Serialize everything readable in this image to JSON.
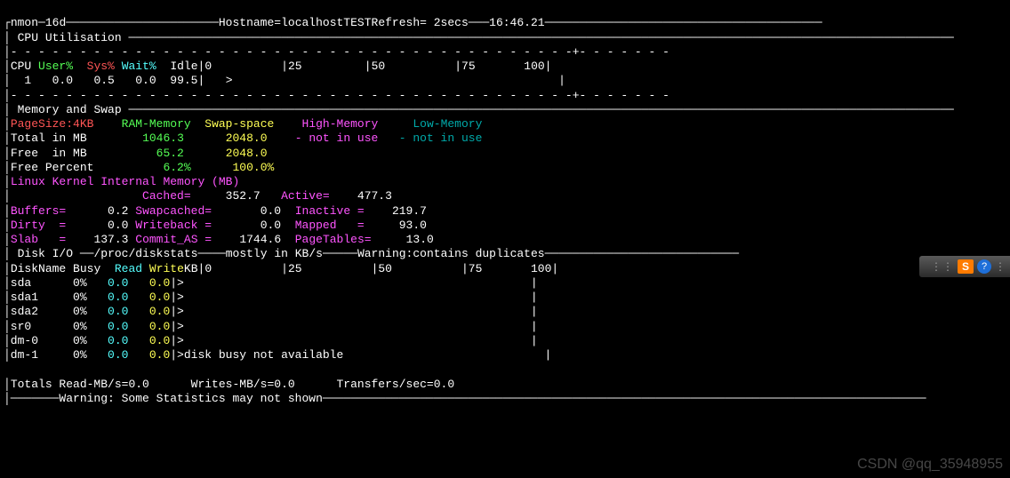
{
  "header": {
    "program": "nmon",
    "version": "16d",
    "hostname": "localhostTEST",
    "refresh": "2secs",
    "time": "16:46.21"
  },
  "cpu_section": {
    "title": "CPU Utilisation",
    "cols": {
      "cpu": "CPU",
      "user": "User%",
      "sys": "Sys%",
      "wait": "Wait%",
      "idle": "Idle"
    },
    "row1": {
      "cpu": "1",
      "user": "0.0",
      "sys": "0.5",
      "wait": "0.0",
      "idle": "99.5",
      "bar": ">"
    },
    "axis": {
      "t0": "0",
      "t25": "25",
      "t50": "50",
      "t75": "75",
      "t100": "100"
    }
  },
  "mem_section": {
    "title": "Memory and Swap",
    "pagesize": "PageSize:4KB",
    "col_ram": "RAM-Memory",
    "col_swap": "Swap-space",
    "col_high": "High-Memory",
    "col_low": "Low-Memory",
    "total_label": "Total in MB",
    "total_ram": "1046.3",
    "total_swap": "2048.0",
    "high_val": "- not in use",
    "low_val": "- not in use",
    "free_label": "Free  in MB",
    "free_ram": "65.2",
    "free_swap": "2048.0",
    "freep_label": "Free Percent",
    "freep_ram": "6.2%",
    "freep_swap": "100.0%",
    "kernel_hdr": "Linux Kernel Internal Memory (MB)",
    "k": {
      "cached_l": "Cached=",
      "cached_v": "352.7",
      "active_l": "Active=",
      "active_v": "477.3",
      "buffers_l": "Buffers=",
      "buffers_v": "0.2",
      "swapc_l": "Swapcached=",
      "swapc_v": "0.0",
      "inactive_l": "Inactive =",
      "inactive_v": "219.7",
      "dirty_l": "Dirty  =",
      "dirty_v": "0.0",
      "wb_l": "Writeback =",
      "wb_v": "0.0",
      "mapped_l": "Mapped   =",
      "mapped_v": "93.0",
      "slab_l": "Slab   =",
      "slab_v": "137.3",
      "commit_l": "Commit_AS =",
      "commit_v": "1744.6",
      "pt_l": "PageTables=",
      "pt_v": "13.0"
    }
  },
  "disk_section": {
    "title": "Disk I/O",
    "src": "/proc/diskstats",
    "units": "mostly in KB/s",
    "warn": "Warning:contains duplicates",
    "cols": {
      "name": "DiskName",
      "busy": "Busy",
      "read": "Read",
      "write": "Write",
      "kb": "KB"
    },
    "rows": [
      {
        "name": "sda",
        "busy": "0%",
        "read": "0.0",
        "write": "0.0",
        "bar": ">"
      },
      {
        "name": "sda1",
        "busy": "0%",
        "read": "0.0",
        "write": "0.0",
        "bar": ">"
      },
      {
        "name": "sda2",
        "busy": "0%",
        "read": "0.0",
        "write": "0.0",
        "bar": ">"
      },
      {
        "name": "sr0",
        "busy": "0%",
        "read": "0.0",
        "write": "0.0",
        "bar": ">"
      },
      {
        "name": "dm-0",
        "busy": "0%",
        "read": "0.0",
        "write": "0.0",
        "bar": ">"
      },
      {
        "name": "dm-1",
        "busy": "0%",
        "read": "0.0",
        "write": "0.0",
        "bar": ">disk busy not available"
      }
    ],
    "totals": {
      "read_l": "Totals Read-MB/s=",
      "read_v": "0.0",
      "write_l": "Writes-MB/s=",
      "write_v": "0.0",
      "xfer_l": "Transfers/sec=",
      "xfer_v": "0.0"
    },
    "bottom_warn": "Warning: Some Statistics may not shown"
  },
  "watermark": "CSDN @qq_35948955"
}
